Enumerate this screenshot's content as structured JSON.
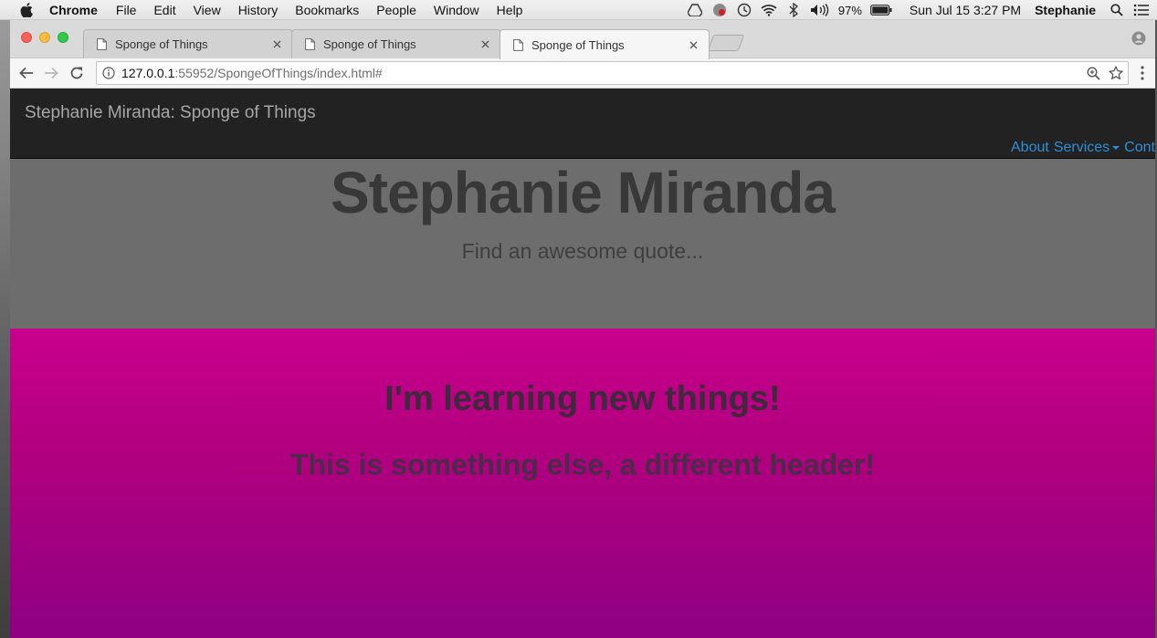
{
  "menubar": {
    "app_name": "Chrome",
    "items": [
      "File",
      "Edit",
      "View",
      "History",
      "Bookmarks",
      "People",
      "Window",
      "Help"
    ],
    "battery": "97%",
    "clock": "Sun Jul 15  3:27 PM",
    "user": "Stephanie",
    "tray_icons": [
      "drive-icon",
      "adblock-icon",
      "time-machine-icon",
      "wifi-icon",
      "bluetooth-icon",
      "volume-icon",
      "battery-icon"
    ]
  },
  "browser": {
    "tabs": [
      {
        "title": "Sponge of Things",
        "active": false
      },
      {
        "title": "Sponge of Things",
        "active": false
      },
      {
        "title": "Sponge of Things",
        "active": true
      }
    ],
    "url_host": "127.0.0.1",
    "url_path": ":55952/SpongeOfThings/index.html#"
  },
  "site": {
    "brand": "Stephanie Miranda: Sponge of Things",
    "nav": {
      "about": "About",
      "services": "Services",
      "contact": "Conta"
    },
    "hero": {
      "title": "Stephanie Miranda",
      "subtitle": "Find an awesome quote..."
    },
    "feature": {
      "heading": "I'm learning new things!",
      "subheading": "This is something else, a different header!"
    }
  },
  "colors": {
    "navbar_bg": "#222222",
    "hero_bg": "#6d6d6d",
    "feature_gradient_top": "#c8008c",
    "feature_gradient_bottom": "#8f0082",
    "link": "#2e8fd8"
  }
}
